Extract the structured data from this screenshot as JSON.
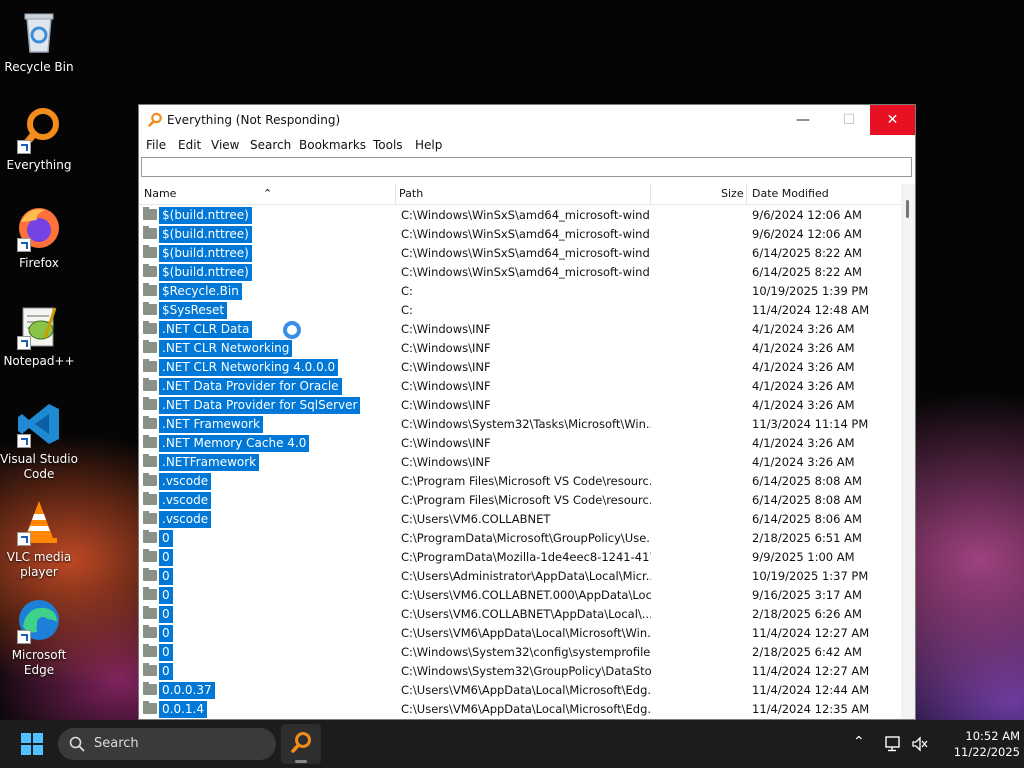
{
  "desktop": {
    "icons": [
      {
        "label": "Recycle Bin"
      },
      {
        "label": "Everything"
      },
      {
        "label": "Firefox"
      },
      {
        "label": "Notepad++"
      },
      {
        "label": "Visual Studio Code"
      },
      {
        "label": "VLC media player"
      },
      {
        "label": "Microsoft Edge"
      }
    ]
  },
  "window": {
    "title": "Everything (Not Responding)",
    "menu": [
      "File",
      "Edit",
      "View",
      "Search",
      "Bookmarks",
      "Tools",
      "Help"
    ],
    "search_value": "",
    "columns": {
      "name": "Name",
      "path": "Path",
      "size": "Size",
      "date": "Date Modified"
    },
    "rows": [
      {
        "name": "$(build.nttree)",
        "path": "C:\\Windows\\WinSxS\\amd64_microsoft-wind...",
        "date": "9/6/2024 12:06 AM"
      },
      {
        "name": "$(build.nttree)",
        "path": "C:\\Windows\\WinSxS\\amd64_microsoft-wind...",
        "date": "9/6/2024 12:06 AM"
      },
      {
        "name": "$(build.nttree)",
        "path": "C:\\Windows\\WinSxS\\amd64_microsoft-wind...",
        "date": "6/14/2025 8:22 AM"
      },
      {
        "name": "$(build.nttree)",
        "path": "C:\\Windows\\WinSxS\\amd64_microsoft-wind...",
        "date": "6/14/2025 8:22 AM"
      },
      {
        "name": "$Recycle.Bin",
        "path": "C:",
        "date": "10/19/2025 1:39 PM"
      },
      {
        "name": "$SysReset",
        "path": "C:",
        "date": "11/4/2024 12:48 AM"
      },
      {
        "name": ".NET CLR Data",
        "path": "C:\\Windows\\INF",
        "date": "4/1/2024 3:26 AM"
      },
      {
        "name": ".NET CLR Networking",
        "path": "C:\\Windows\\INF",
        "date": "4/1/2024 3:26 AM"
      },
      {
        "name": ".NET CLR Networking 4.0.0.0",
        "path": "C:\\Windows\\INF",
        "date": "4/1/2024 3:26 AM"
      },
      {
        "name": ".NET Data Provider for Oracle",
        "path": "C:\\Windows\\INF",
        "date": "4/1/2024 3:26 AM"
      },
      {
        "name": ".NET Data Provider for SqlServer",
        "path": "C:\\Windows\\INF",
        "date": "4/1/2024 3:26 AM"
      },
      {
        "name": ".NET Framework",
        "path": "C:\\Windows\\System32\\Tasks\\Microsoft\\Win...",
        "date": "11/3/2024 11:14 PM"
      },
      {
        "name": ".NET Memory Cache 4.0",
        "path": "C:\\Windows\\INF",
        "date": "4/1/2024 3:26 AM"
      },
      {
        "name": ".NETFramework",
        "path": "C:\\Windows\\INF",
        "date": "4/1/2024 3:26 AM"
      },
      {
        "name": ".vscode",
        "path": "C:\\Program Files\\Microsoft VS Code\\resourc...",
        "date": "6/14/2025 8:08 AM"
      },
      {
        "name": ".vscode",
        "path": "C:\\Program Files\\Microsoft VS Code\\resourc...",
        "date": "6/14/2025 8:08 AM"
      },
      {
        "name": ".vscode",
        "path": "C:\\Users\\VM6.COLLABNET",
        "date": "6/14/2025 8:06 AM"
      },
      {
        "name": "0",
        "path": "C:\\ProgramData\\Microsoft\\GroupPolicy\\Use...",
        "date": "2/18/2025 6:51 AM"
      },
      {
        "name": "0",
        "path": "C:\\ProgramData\\Mozilla-1de4eec8-1241-417...",
        "date": "9/9/2025 1:00 AM"
      },
      {
        "name": "0",
        "path": "C:\\Users\\Administrator\\AppData\\Local\\Micr...",
        "date": "10/19/2025 1:37 PM"
      },
      {
        "name": "0",
        "path": "C:\\Users\\VM6.COLLABNET.000\\AppData\\Loc...",
        "date": "9/16/2025 3:17 AM"
      },
      {
        "name": "0",
        "path": "C:\\Users\\VM6.COLLABNET\\AppData\\Local\\...",
        "date": "2/18/2025 6:26 AM"
      },
      {
        "name": "0",
        "path": "C:\\Users\\VM6\\AppData\\Local\\Microsoft\\Win...",
        "date": "11/4/2024 12:27 AM"
      },
      {
        "name": "0",
        "path": "C:\\Windows\\System32\\config\\systemprofile...",
        "date": "2/18/2025 6:42 AM"
      },
      {
        "name": "0",
        "path": "C:\\Windows\\System32\\GroupPolicy\\DataStore",
        "date": "11/4/2024 12:27 AM"
      },
      {
        "name": "0.0.0.37",
        "path": "C:\\Users\\VM6\\AppData\\Local\\Microsoft\\Edg...",
        "date": "11/4/2024 12:44 AM"
      },
      {
        "name": "0.0.1.4",
        "path": "C:\\Users\\VM6\\AppData\\Local\\Microsoft\\Edg...",
        "date": "11/4/2024 12:35 AM"
      }
    ]
  },
  "taskbar": {
    "search_label": "Search",
    "time": "10:52 AM",
    "date": "11/22/2025"
  },
  "colors": {
    "selection": "#0078d7",
    "close_button": "#e81123",
    "taskbar": "#1c1c1c"
  }
}
